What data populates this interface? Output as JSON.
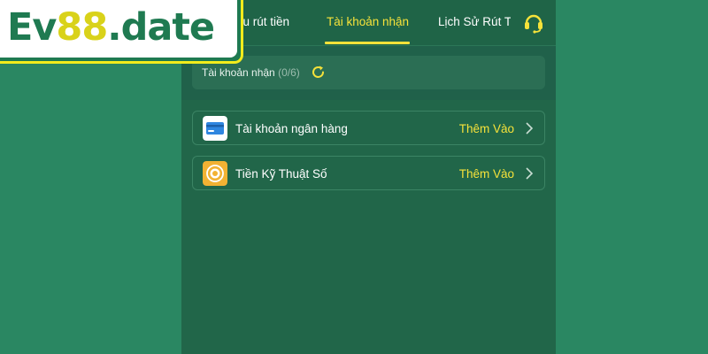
{
  "logo": {
    "part1": "Ev",
    "part2": "88",
    "part3": ".date"
  },
  "nav": {
    "tabs": [
      {
        "label": "ầu rút tiền",
        "active": false
      },
      {
        "label": "Tài khoản nhận",
        "active": true
      },
      {
        "label": "Lịch Sử Rút T",
        "active": false
      }
    ],
    "support_icon": "headset-icon"
  },
  "accounts": {
    "label": "Tài khoản nhận",
    "count": "(0/6)",
    "refresh_icon": "refresh-icon"
  },
  "rows": [
    {
      "label": "Tài khoản ngân hàng",
      "action": "Thêm Vào",
      "icon": "bank-card-icon"
    },
    {
      "label": "Tiền Kỹ Thuật Số",
      "action": "Thêm Vào",
      "icon": "crypto-coin-icon"
    }
  ],
  "colors": {
    "background": "#2a8762",
    "panel": "#20614a",
    "accent_yellow": "#f6e23a",
    "logo_green": "#1f7a51"
  }
}
